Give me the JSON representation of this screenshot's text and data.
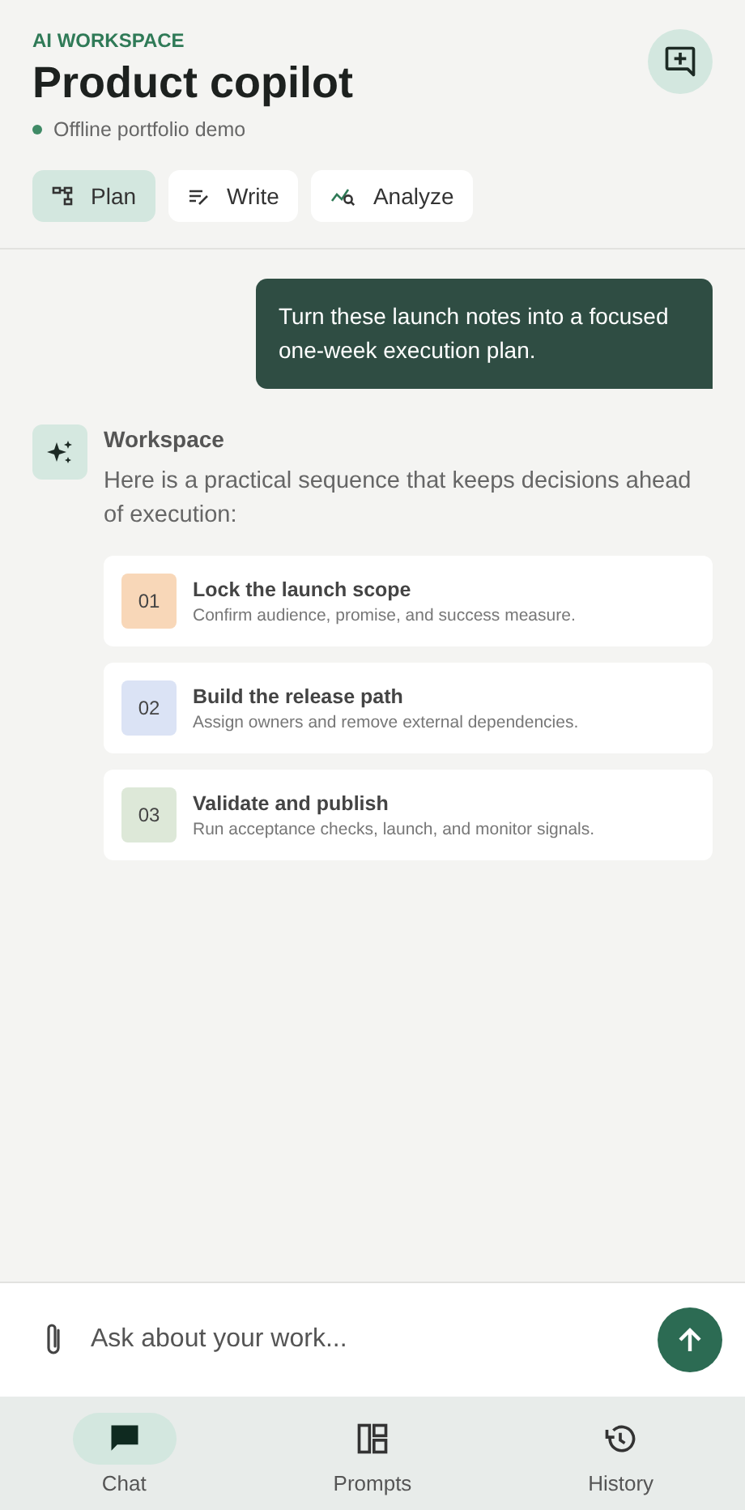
{
  "header": {
    "eyebrow": "AI WORKSPACE",
    "title": "Product copilot",
    "status": "Offline portfolio demo"
  },
  "modes": [
    {
      "label": "Plan",
      "selected": true
    },
    {
      "label": "Write",
      "selected": false
    },
    {
      "label": "Analyze",
      "selected": false
    }
  ],
  "user_message": "Turn these launch notes into a focused one-week execution plan.",
  "reply": {
    "sender": "Workspace",
    "text": "Here is a practical sequence that keeps decisions ahead of execution:",
    "steps": [
      {
        "number": "01",
        "title": "Lock the launch scope",
        "detail": "Confirm audience, promise, and success measure.",
        "color": "#f8d7b8"
      },
      {
        "number": "02",
        "title": "Build the release path",
        "detail": "Assign owners and remove external dependencies.",
        "color": "#dbe3f5"
      },
      {
        "number": "03",
        "title": "Validate and publish",
        "detail": "Run acceptance checks, launch, and monitor signals.",
        "color": "#dde8d8"
      }
    ]
  },
  "composer": {
    "placeholder": "Ask about your work..."
  },
  "nav": [
    {
      "label": "Chat",
      "selected": true
    },
    {
      "label": "Prompts",
      "selected": false
    },
    {
      "label": "History",
      "selected": false
    }
  ]
}
